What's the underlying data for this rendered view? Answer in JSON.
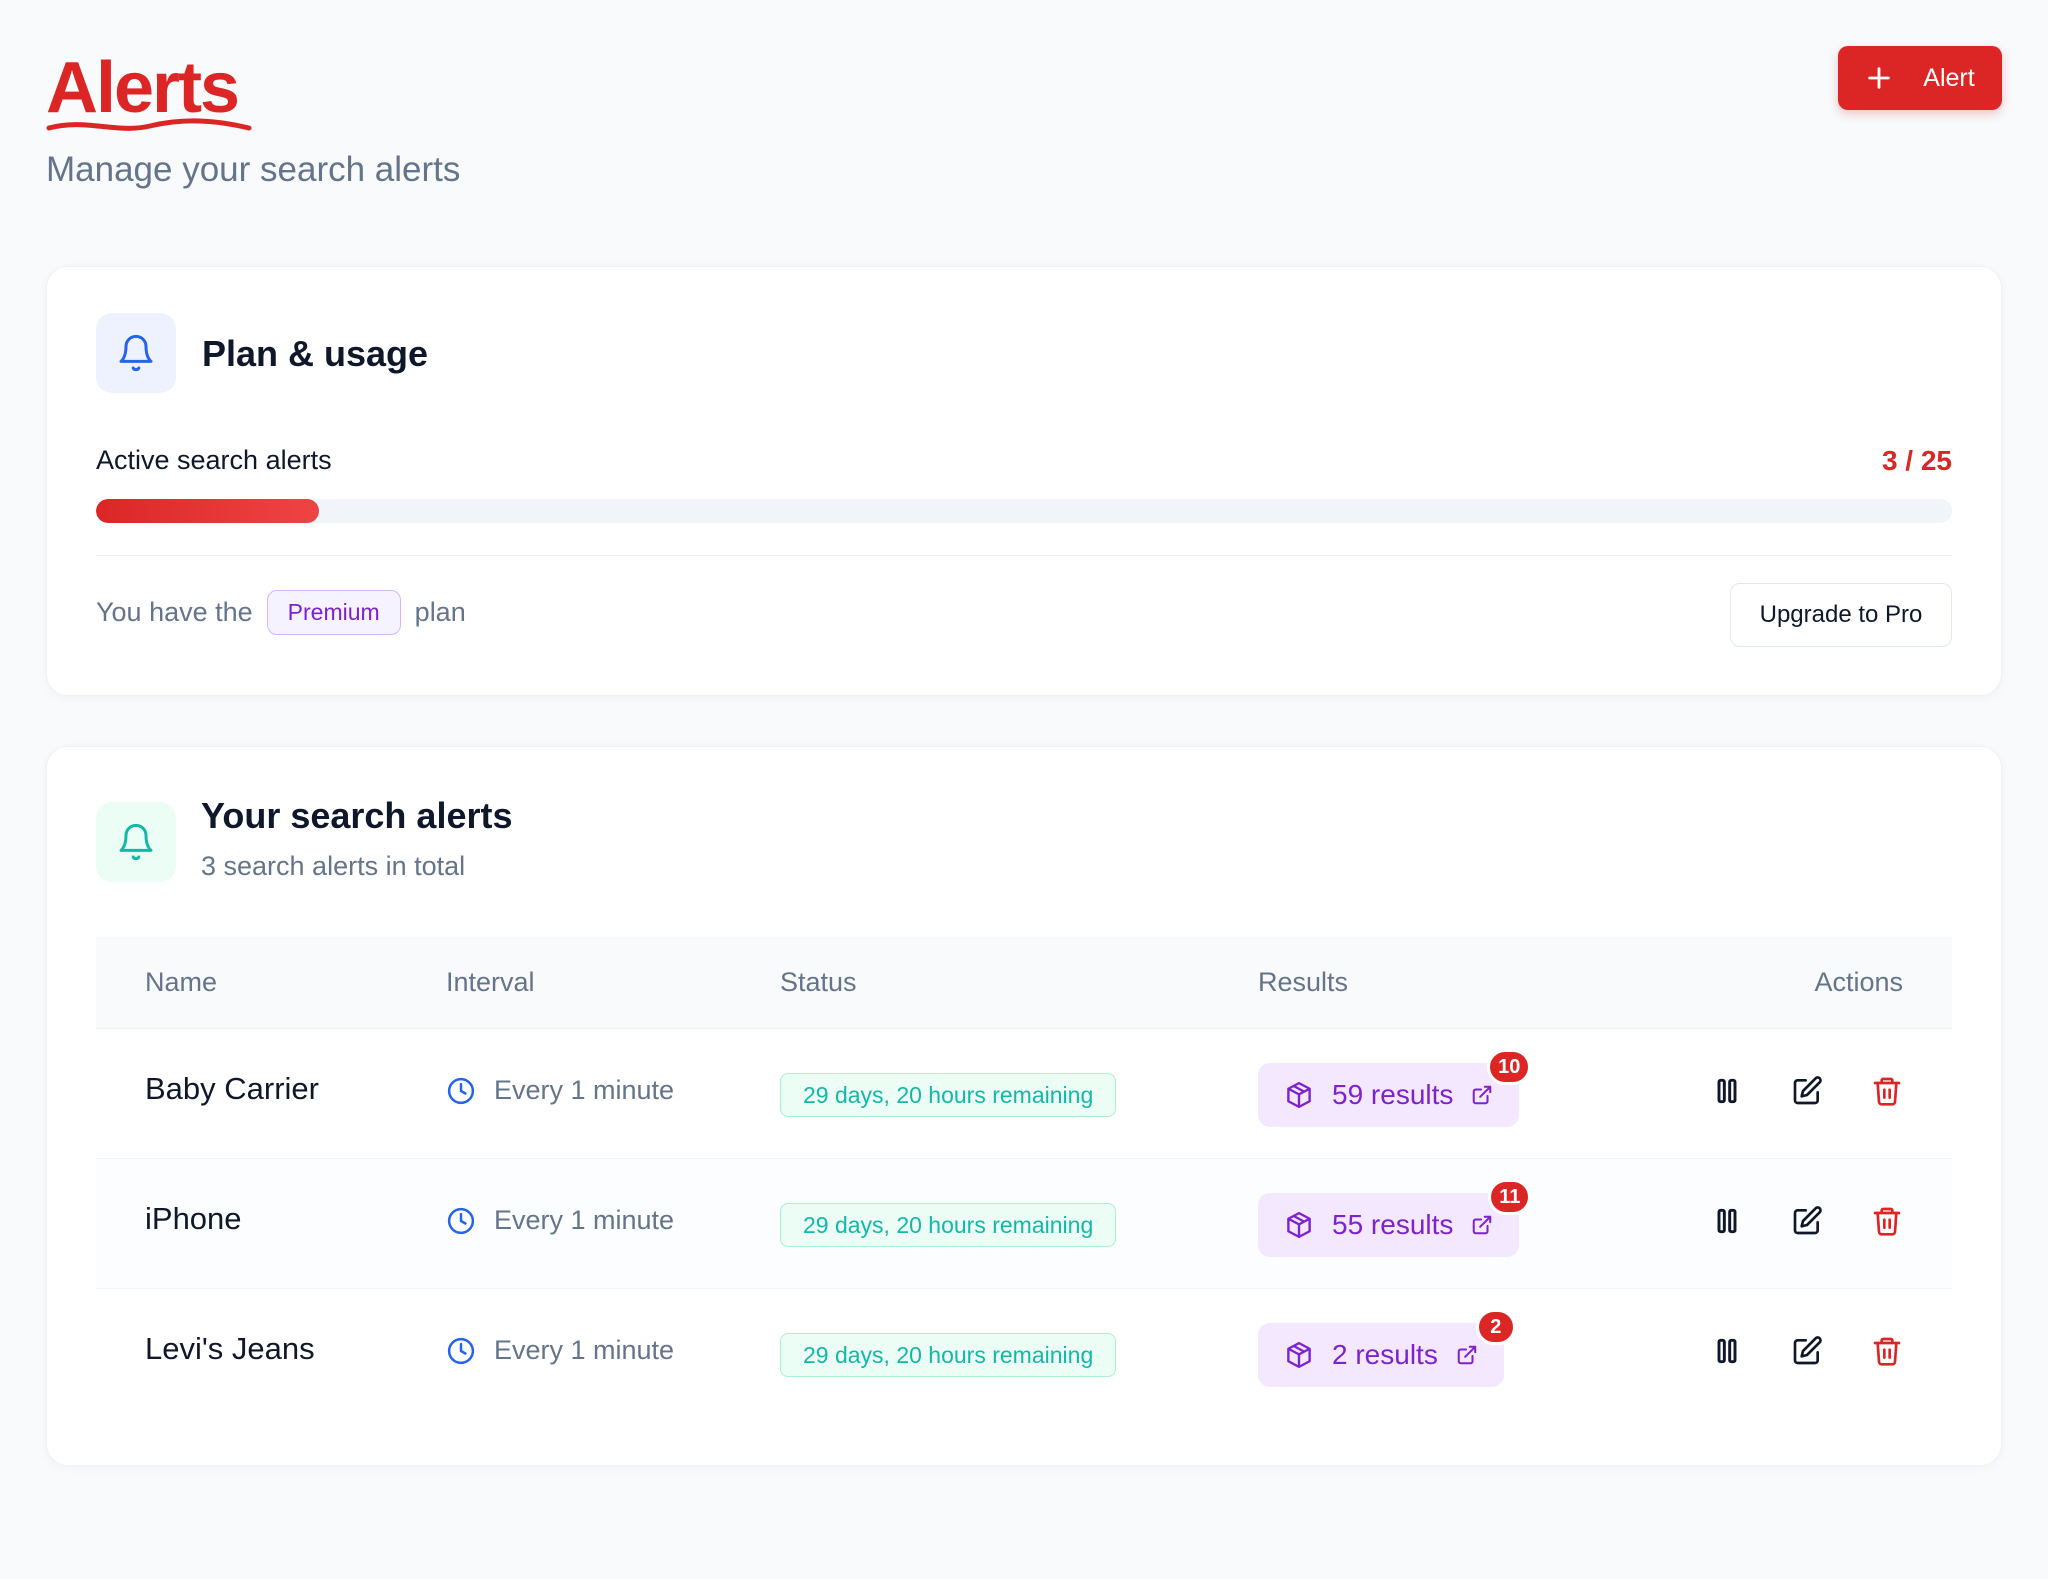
{
  "header": {
    "title": "Alerts",
    "subtitle": "Manage your search alerts",
    "add_button_label": "Alert"
  },
  "plan": {
    "title": "Plan & usage",
    "usage_label": "Active search alerts",
    "usage_count": "3 / 25",
    "usage_fraction": 0.12,
    "plan_prefix": "You have the",
    "plan_name": "Premium",
    "plan_suffix": "plan",
    "upgrade_label": "Upgrade to Pro"
  },
  "alerts": {
    "title": "Your search alerts",
    "subtitle": "3 search alerts in total",
    "columns": [
      "Name",
      "Interval",
      "Status",
      "Results",
      "Actions"
    ],
    "rows": [
      {
        "name": "Baby Carrier",
        "interval": "Every 1 minute",
        "status": "29 days, 20 hours remaining",
        "results": "59 results",
        "new_count": "10"
      },
      {
        "name": "iPhone",
        "interval": "Every 1 minute",
        "status": "29 days, 20 hours remaining",
        "results": "55 results",
        "new_count": "11"
      },
      {
        "name": "Levi's Jeans",
        "interval": "Every 1 minute",
        "status": "29 days, 20 hours remaining",
        "results": "2 results",
        "new_count": "2"
      }
    ]
  },
  "colors": {
    "accent": "#dc2626",
    "premium": "#7e22ce",
    "status": "#14b8a6",
    "interval_icon": "#2563eb"
  },
  "icons": {
    "add": "plus-icon",
    "plan": "bell-icon",
    "alerts": "bell-icon",
    "interval": "clock-icon",
    "results": "box-icon",
    "open": "external-link-icon",
    "pause": "pause-icon",
    "edit": "edit-icon",
    "delete": "trash-icon"
  }
}
